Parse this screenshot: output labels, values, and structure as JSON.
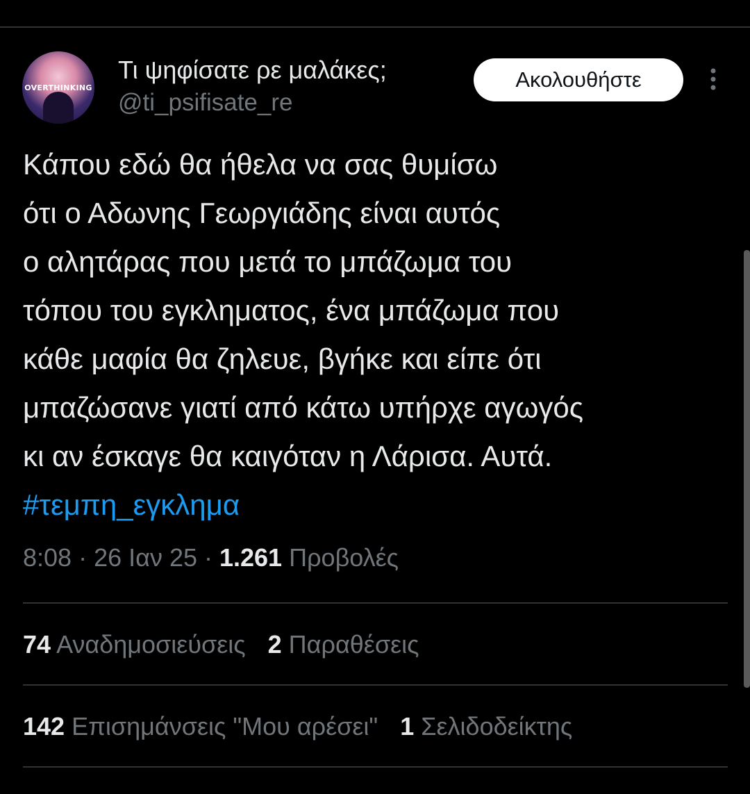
{
  "account": {
    "display_name": "Τι ψηφίσατε ρε μαλάκες;",
    "username": "@ti_psifisate_re",
    "avatar_text": "OVERTHINKING",
    "follow_label": "Ακολουθήστε"
  },
  "tweet": {
    "lines": [
      "Κάπου εδώ θα ήθελα να σας θυμίσω",
      "ότι ο Αδωνης Γεωργιάδης είναι αυτός",
      "ο αλητάρας που μετά το μπάζωμα του",
      "τόπου του εγκληματος, ένα μπάζωμα που",
      "κάθε μαφία θα ζηλευε, βγήκε και είπε ότι",
      "μπαζώσανε γιατί από κάτω υπήρχε αγωγός",
      "κι αν έσκαγε θα καιγόταν η Λάρισα. Αυτά."
    ],
    "hashtag": "#τεμπη_εγκλημα"
  },
  "meta": {
    "time": "8:08",
    "separator": " · ",
    "date": "26 Ιαν 25",
    "views_count": "1.261",
    "views_label": " Προβολές"
  },
  "stats": {
    "reposts_count": "74",
    "reposts_label": " Αναδημοσιεύσεις",
    "quotes_count": "2",
    "quotes_label": " Παραθέσεις",
    "likes_count": "142",
    "likes_label": " Επισημάνσεις \"Μου αρέσει\"",
    "bookmarks_count": "1",
    "bookmarks_label": " Σελιδοδείκτης"
  },
  "icons": {
    "more": "more-vertical-icon"
  },
  "colors": {
    "background": "#000000",
    "text": "#e7e9ea",
    "secondary_text": "#71767b",
    "hashtag": "#1d9bf0",
    "divider": "#2f3336",
    "follow_button_bg": "#ffffff"
  }
}
